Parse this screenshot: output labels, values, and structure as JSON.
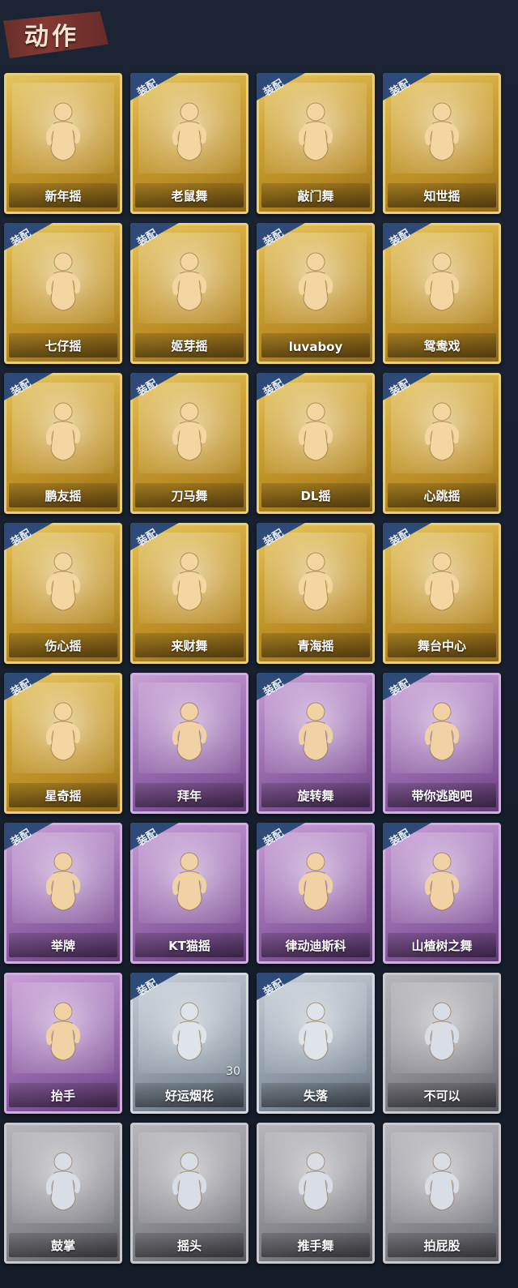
{
  "header": {
    "title": "动作"
  },
  "equip_label": "装配",
  "cards": [
    {
      "label": "新年摇",
      "rarity": "gold",
      "equipped": false
    },
    {
      "label": "老鼠舞",
      "rarity": "gold",
      "equipped": true
    },
    {
      "label": "敲门舞",
      "rarity": "gold",
      "equipped": true
    },
    {
      "label": "知世摇",
      "rarity": "gold",
      "equipped": true
    },
    {
      "label": "七仔摇",
      "rarity": "gold",
      "equipped": true
    },
    {
      "label": "姬芽摇",
      "rarity": "gold",
      "equipped": true
    },
    {
      "label": "luvaboy",
      "rarity": "gold",
      "equipped": true
    },
    {
      "label": "鸳鸯戏",
      "rarity": "gold",
      "equipped": true
    },
    {
      "label": "鹏友摇",
      "rarity": "gold",
      "equipped": true
    },
    {
      "label": "刀马舞",
      "rarity": "gold",
      "equipped": true
    },
    {
      "label": "DL摇",
      "rarity": "gold",
      "equipped": true
    },
    {
      "label": "心跳摇",
      "rarity": "gold",
      "equipped": true
    },
    {
      "label": "伤心摇",
      "rarity": "gold",
      "equipped": true
    },
    {
      "label": "来财舞",
      "rarity": "gold",
      "equipped": true
    },
    {
      "label": "青海摇",
      "rarity": "gold",
      "equipped": true
    },
    {
      "label": "舞台中心",
      "rarity": "gold",
      "equipped": true
    },
    {
      "label": "星奇摇",
      "rarity": "gold",
      "equipped": true
    },
    {
      "label": "拜年",
      "rarity": "purple",
      "equipped": false
    },
    {
      "label": "旋转舞",
      "rarity": "purple",
      "equipped": true
    },
    {
      "label": "带你逃跑吧",
      "rarity": "purple",
      "equipped": true
    },
    {
      "label": "举牌",
      "rarity": "purple",
      "equipped": true
    },
    {
      "label": "KT猫摇",
      "rarity": "purple",
      "equipped": true
    },
    {
      "label": "律动迪斯科",
      "rarity": "purple",
      "equipped": true
    },
    {
      "label": "山楂树之舞",
      "rarity": "purple",
      "equipped": true
    },
    {
      "label": "抬手",
      "rarity": "purple",
      "equipped": false
    },
    {
      "label": "好运烟花",
      "rarity": "gray",
      "equipped": true,
      "count": "30"
    },
    {
      "label": "失落",
      "rarity": "gray",
      "equipped": true
    },
    {
      "label": "不可以",
      "rarity": "silver",
      "equipped": false
    },
    {
      "label": "鼓掌",
      "rarity": "silver",
      "equipped": false
    },
    {
      "label": "摇头",
      "rarity": "silver",
      "equipped": false
    },
    {
      "label": "推手舞",
      "rarity": "silver",
      "equipped": false
    },
    {
      "label": "拍屁股",
      "rarity": "silver",
      "equipped": false
    }
  ]
}
